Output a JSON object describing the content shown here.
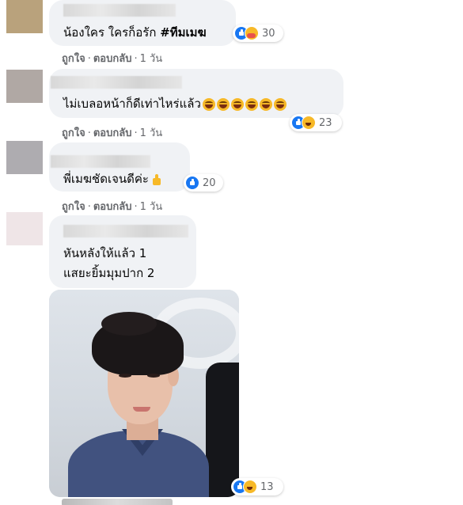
{
  "comments": [
    {
      "text": "น้องใคร ใครก็อรัก ",
      "hashtag": "#ทีมเมฆ",
      "reaction_count": "30",
      "reactions": [
        "like",
        "care"
      ]
    },
    {
      "text": "ไม่เบลอหน้าก็ดีเท่าไหร่แล้ว",
      "emoji_icons": [
        "laughing-icon",
        "laughing-icon",
        "laughing-icon",
        "laughing-icon",
        "laughing-icon",
        "laughing-icon"
      ],
      "reaction_count": "23",
      "reactions": [
        "like",
        "haha"
      ]
    },
    {
      "text": "พี่เมฆชัดเจนดีค่ะ",
      "emoji_icons": [
        "thumbs-up-icon"
      ],
      "reaction_count": "20",
      "reactions": [
        "like"
      ]
    },
    {
      "line1": "หันหลังให้แล้ว 1",
      "line2": "แสยะยิ้มมุมปาก 2",
      "reaction_count": "13",
      "reactions": [
        "like",
        "haha"
      ]
    }
  ],
  "actions": {
    "like": "ถูกใจ",
    "separator": "·",
    "reply": "ตอบกลับ",
    "time": "1 วัน"
  },
  "colors": {
    "bubble": "#f0f2f5",
    "like_blue": "#1877f2",
    "meta_gray": "#65676b",
    "emoji_yellow": "#f7b928"
  }
}
